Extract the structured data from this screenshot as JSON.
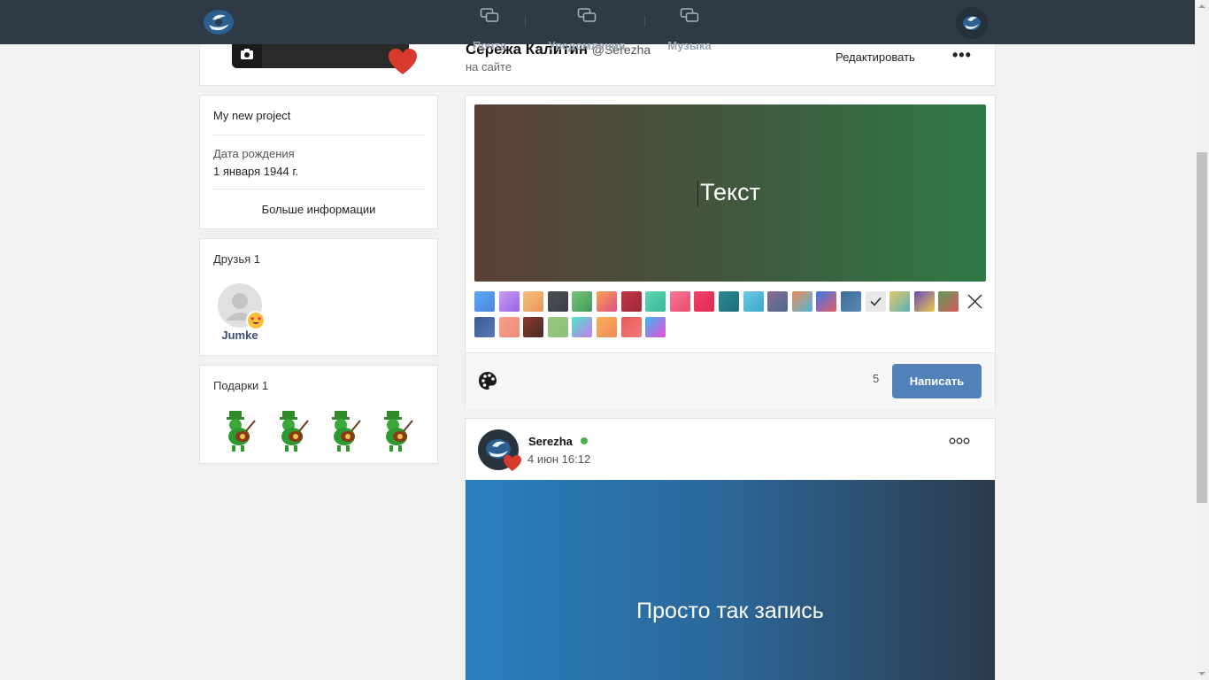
{
  "topbar": {
    "nav": [
      {
        "label": "Почта",
        "icon": "chat-icon"
      },
      {
        "label": "Уведомления",
        "icon": "chat-icon"
      },
      {
        "label": "Музыка",
        "icon": "chat-icon"
      }
    ]
  },
  "profile": {
    "name": "Сережа Калитин",
    "handle": "@Serezha",
    "status": "на сайте",
    "edit_label": "Редактировать",
    "more_label": "•••"
  },
  "info": {
    "project": "My new project",
    "birthday_label": "Дата рождения",
    "birthday_value": "1 января 1944 г.",
    "more_info_label": "Больше информации"
  },
  "friends": {
    "title": "Друзья 1",
    "items": [
      {
        "name": "Jumke"
      }
    ]
  },
  "gifts": {
    "title": "Подарки 1",
    "count_shown": 4
  },
  "composer": {
    "preview_text": "Текст",
    "swatch_colors_row1": [
      [
        "#5ea8f5",
        "#4a86e0"
      ],
      [
        "#c79ef5",
        "#9a60e8"
      ],
      [
        "#f7c07a",
        "#e8955a"
      ],
      [
        "#4a4e55",
        "#3c4046"
      ],
      [
        "#7bc47b",
        "#3e9a5a"
      ],
      [
        "#f7a050",
        "#e0508a"
      ],
      [
        "#c0354a",
        "#a02838"
      ],
      [
        "#5fd6b4",
        "#3ab898"
      ],
      [
        "#f77a95",
        "#ea4a6e"
      ],
      [
        "#f0406a",
        "#e02a55"
      ],
      [
        "#2c8a95",
        "#1e6c7a"
      ],
      [
        "#6fc8e8",
        "#3aa8c8"
      ],
      [
        "#8a6a95",
        "#4a6a8a"
      ],
      [
        "#f08a5a",
        "#4ab8d8"
      ],
      [
        "#3a7ae8",
        "#e85a6a"
      ],
      [
        "#3a6a95",
        "#5a8ab5"
      ],
      [
        "#e8e8e8",
        "#e8e8e8"
      ],
      [
        "#e8c86a",
        "#5ab0b8"
      ],
      [
        "#6a4ab8",
        "#e8c84a"
      ],
      [
        "#5a9a5a",
        "#d85a5a"
      ]
    ],
    "swatch_colors_row2": [
      [
        "#3a5a95",
        "#5a7ab8"
      ],
      [
        "#f7a08a",
        "#f08a7a"
      ],
      [
        "#8a3a2a",
        "#4a2a2a"
      ],
      [
        "#9ac87a",
        "#8ac07a"
      ],
      [
        "#4ae8c8",
        "#c87af0"
      ],
      [
        "#f7b05a",
        "#f08a5a"
      ],
      [
        "#e85a5a",
        "#f07a7a"
      ],
      [
        "#3ab8f0",
        "#f04ad8"
      ]
    ],
    "char_count": "5",
    "post_label": "Написать"
  },
  "post": {
    "author": "Serezha",
    "date": "4 июн 16:12",
    "text": "Просто так запись"
  }
}
